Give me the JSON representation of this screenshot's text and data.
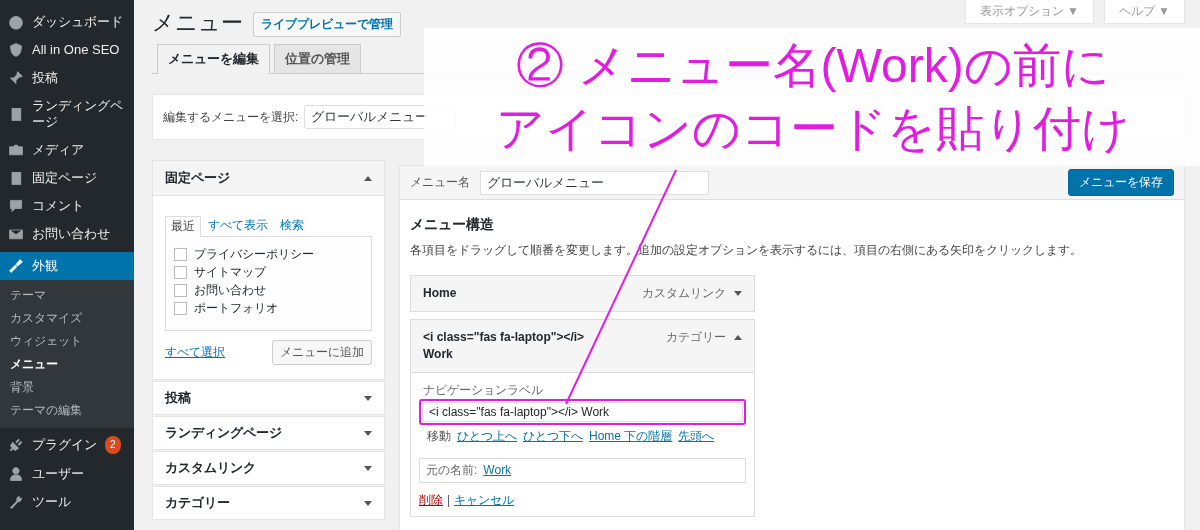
{
  "sidebar": {
    "items": [
      {
        "label": "ダッシュボード",
        "selected": false
      },
      {
        "label": "All in One SEO",
        "selected": false
      },
      {
        "label": "投稿",
        "selected": false
      },
      {
        "label": "ランディングページ",
        "selected": false
      },
      {
        "label": "メディア",
        "selected": false
      },
      {
        "label": "固定ページ",
        "selected": false
      },
      {
        "label": "コメント",
        "selected": false
      },
      {
        "label": "お問い合わせ",
        "selected": false
      },
      {
        "label": "外観",
        "selected": true,
        "children": [
          {
            "label": "テーマ",
            "selected": false
          },
          {
            "label": "カスタマイズ",
            "selected": false
          },
          {
            "label": "ウィジェット",
            "selected": false
          },
          {
            "label": "メニュー",
            "selected": true
          },
          {
            "label": "背景",
            "selected": false
          },
          {
            "label": "テーマの編集",
            "selected": false
          }
        ]
      },
      {
        "label": "プラグイン",
        "selected": false,
        "badge": "2"
      },
      {
        "label": "ユーザー",
        "selected": false
      },
      {
        "label": "ツール",
        "selected": false
      }
    ]
  },
  "top_buttons": [
    {
      "label": "表示オプション",
      "caret": "▼"
    },
    {
      "label": "ヘルプ",
      "caret": "▼"
    }
  ],
  "page": {
    "title": "メニュー",
    "live_preview_button": "ライブプレビューで管理"
  },
  "tabs": [
    {
      "label": "メニューを編集",
      "selected": true
    },
    {
      "label": "位置の管理",
      "selected": false
    }
  ],
  "menu_select": {
    "label": "編集するメニューを選択:",
    "value": "グローバルメニュー"
  },
  "add_panels": [
    {
      "title": "固定ページ",
      "expanded": true,
      "tabs": [
        {
          "label": "最近",
          "selected": true
        },
        {
          "label": "すべて表示",
          "selected": false
        },
        {
          "label": "検索",
          "selected": false
        }
      ],
      "items": [
        {
          "label": "プライバシーポリシー",
          "checked": false
        },
        {
          "label": "サイトマップ",
          "checked": false
        },
        {
          "label": "お問い合わせ",
          "checked": false
        },
        {
          "label": "ポートフォリオ",
          "checked": false
        }
      ],
      "select_all": "すべて選択",
      "add_button": "メニューに追加"
    },
    {
      "title": "投稿",
      "expanded": false
    },
    {
      "title": "ランディングページ",
      "expanded": false
    },
    {
      "title": "カスタムリンク",
      "expanded": false
    },
    {
      "title": "カテゴリー",
      "expanded": false
    }
  ],
  "menu_editor": {
    "name_label": "メニュー名",
    "name_value": "グローバルメニュー",
    "save_button": "メニューを保存",
    "heading": "メニュー構造",
    "description": "各項目をドラッグして順番を変更します。追加の設定オプションを表示するには、項目の右側にある矢印をクリックします。",
    "items": [
      {
        "title": "Home",
        "type": "カスタムリンク",
        "expanded": false
      },
      {
        "title": "<i class=\"fas fa-laptop\"></i> Work",
        "type": "カテゴリー",
        "expanded": true,
        "nav_label_caption": "ナビゲーションラベル",
        "nav_label_value": "<i class=\"fas fa-laptop\"></i> Work",
        "move_label": "移動",
        "move_links": [
          "ひとつ上へ",
          "ひとつ下へ",
          "Home 下の階層",
          "先頭へ"
        ],
        "original_label": "元の名前:",
        "original_link": "Work",
        "delete_link": "削除",
        "separator": "|",
        "cancel_link": "キャンセル"
      }
    ]
  },
  "annotation": {
    "lines": [
      "② メニュー名(Work)の前に",
      "アイコンのコードを貼り付け"
    ]
  }
}
